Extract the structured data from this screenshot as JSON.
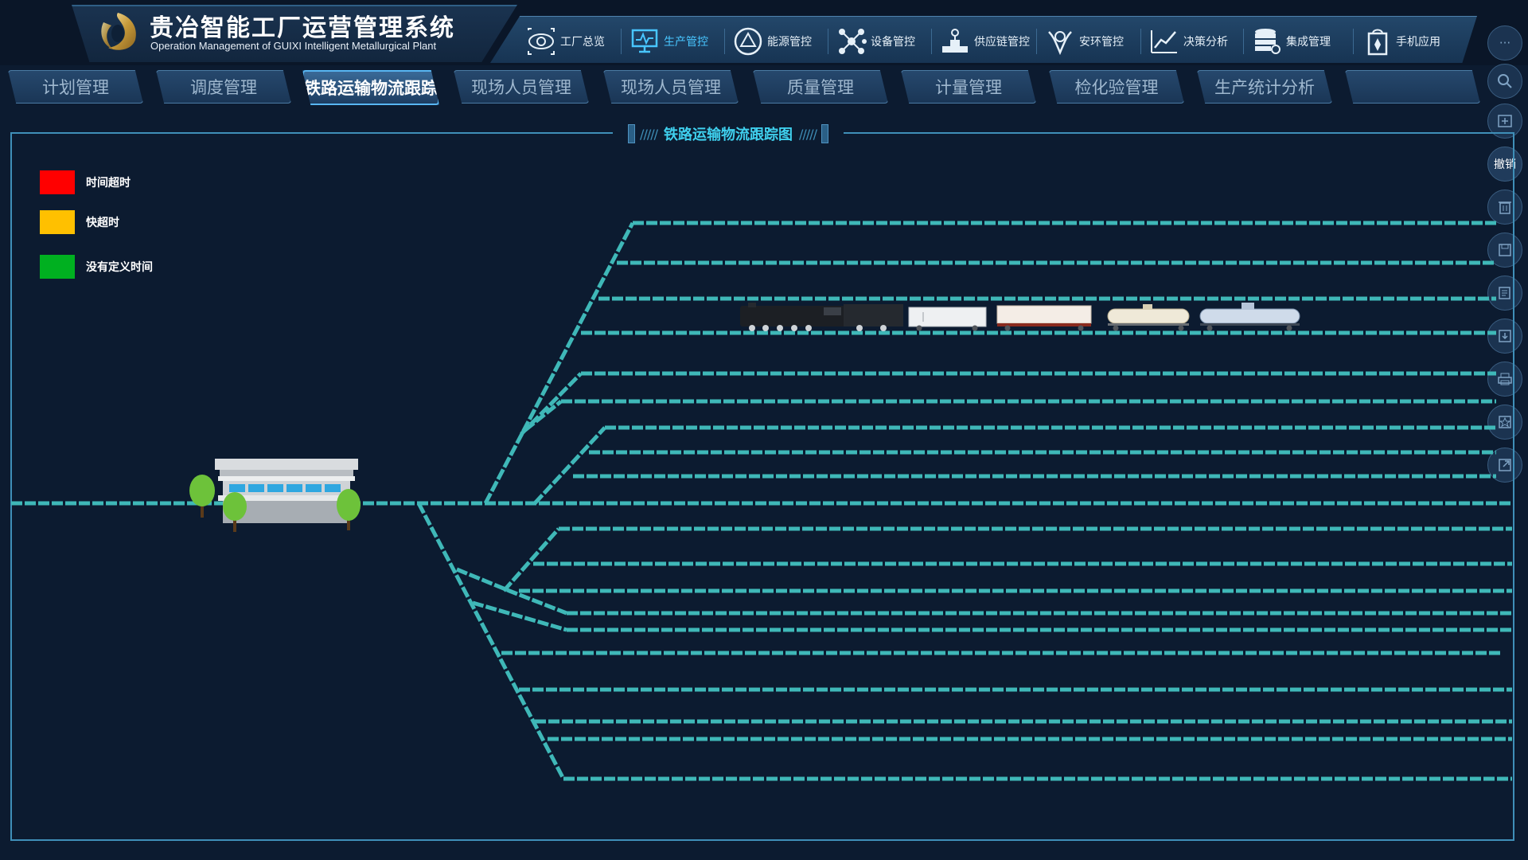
{
  "app": {
    "title": "贵冶智能工厂运营管理系统",
    "subtitle": "Operation Management  of GUIXI Intelligent Metallurgical Plant"
  },
  "top_nav": [
    {
      "label": "工厂总览",
      "icon": "eye-icon"
    },
    {
      "label": "生产管控",
      "icon": "monitor-icon",
      "active": true
    },
    {
      "label": "能源管控",
      "icon": "recycle-icon"
    },
    {
      "label": "设备管控",
      "icon": "network-icon"
    },
    {
      "label": "供应链管控",
      "icon": "supply-icon"
    },
    {
      "label": "安环管控",
      "icon": "safety-icon"
    },
    {
      "label": "决策分析",
      "icon": "trend-icon"
    },
    {
      "label": "集成管理",
      "icon": "database-icon"
    },
    {
      "label": "手机应用",
      "icon": "mobile-bag-icon"
    }
  ],
  "tabs": [
    "计划管理",
    "调度管理",
    "铁路运输物流跟踪",
    "现场人员管理",
    "现场人员管理",
    "质量管理",
    "计量管理",
    "检化验管理",
    "生产统计分析",
    ""
  ],
  "active_tab_index": 2,
  "sidebar": {
    "more_icon": "more-icon",
    "search_icon": "search-icon",
    "add_icon": "add-icon",
    "undo_label": "撤销",
    "delete_icon": "trash-icon",
    "save_icon": "save-icon",
    "edit_icon": "edit-icon",
    "download_icon": "download-icon",
    "print_icon": "print-icon",
    "bookmark_icon": "bookmark-icon",
    "export_icon": "export-icon"
  },
  "panel": {
    "title": "铁路运输物流跟踪图",
    "deco": "/////"
  },
  "legend": [
    {
      "label": "时间超时",
      "color": "#ff0000"
    },
    {
      "label": "快超时",
      "color": "#ffc000"
    },
    {
      "label": "没有定义时间",
      "color": "#00b020"
    }
  ],
  "colors": {
    "track": "#3fb8b8",
    "track_dash": "#1e6f72",
    "accent": "#48c6ff"
  },
  "train": {
    "cars": [
      "locomotive",
      "white-boxcar",
      "flatcar-container",
      "tank-car-cream",
      "tank-car-blue"
    ]
  }
}
